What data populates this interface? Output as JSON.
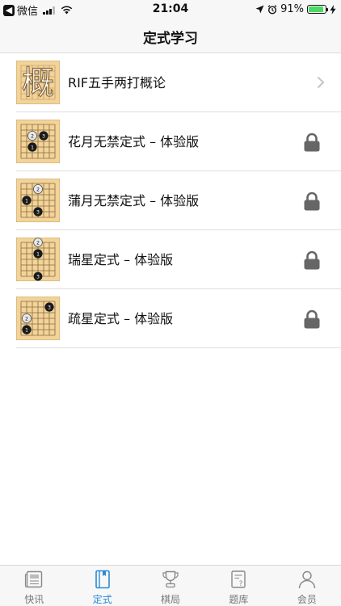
{
  "status_bar": {
    "back_app": "微信",
    "time": "21:04",
    "battery": "91%",
    "battery_level": 0.91
  },
  "nav": {
    "title": "定式学习"
  },
  "list": {
    "items": [
      {
        "label": "RIF五手两打概论",
        "thumb_char": "概",
        "locked": false,
        "trailing_icon": "chevron-right-icon"
      },
      {
        "label": "花月无禁定式 – 体验版",
        "locked": true,
        "trailing_icon": "lock-icon"
      },
      {
        "label": "蒲月无禁定式 – 体验版",
        "locked": true,
        "trailing_icon": "lock-icon"
      },
      {
        "label": "瑞星定式 – 体验版",
        "locked": true,
        "trailing_icon": "lock-icon"
      },
      {
        "label": "疏星定式 – 体验版",
        "locked": true,
        "trailing_icon": "lock-icon"
      }
    ]
  },
  "tab_bar": {
    "tabs": [
      {
        "label": "快讯",
        "icon": "newspaper-icon",
        "active": false
      },
      {
        "label": "定式",
        "icon": "book-icon",
        "active": true
      },
      {
        "label": "棋局",
        "icon": "trophy-icon",
        "active": false
      },
      {
        "label": "题库",
        "icon": "question-doc-icon",
        "active": false
      },
      {
        "label": "会员",
        "icon": "person-icon",
        "active": false
      }
    ]
  },
  "colors": {
    "accent": "#2a8bd6",
    "board": "#f2d39a",
    "grid": "#8a6a3a",
    "lock": "#666666",
    "tab_inactive": "#777777"
  }
}
